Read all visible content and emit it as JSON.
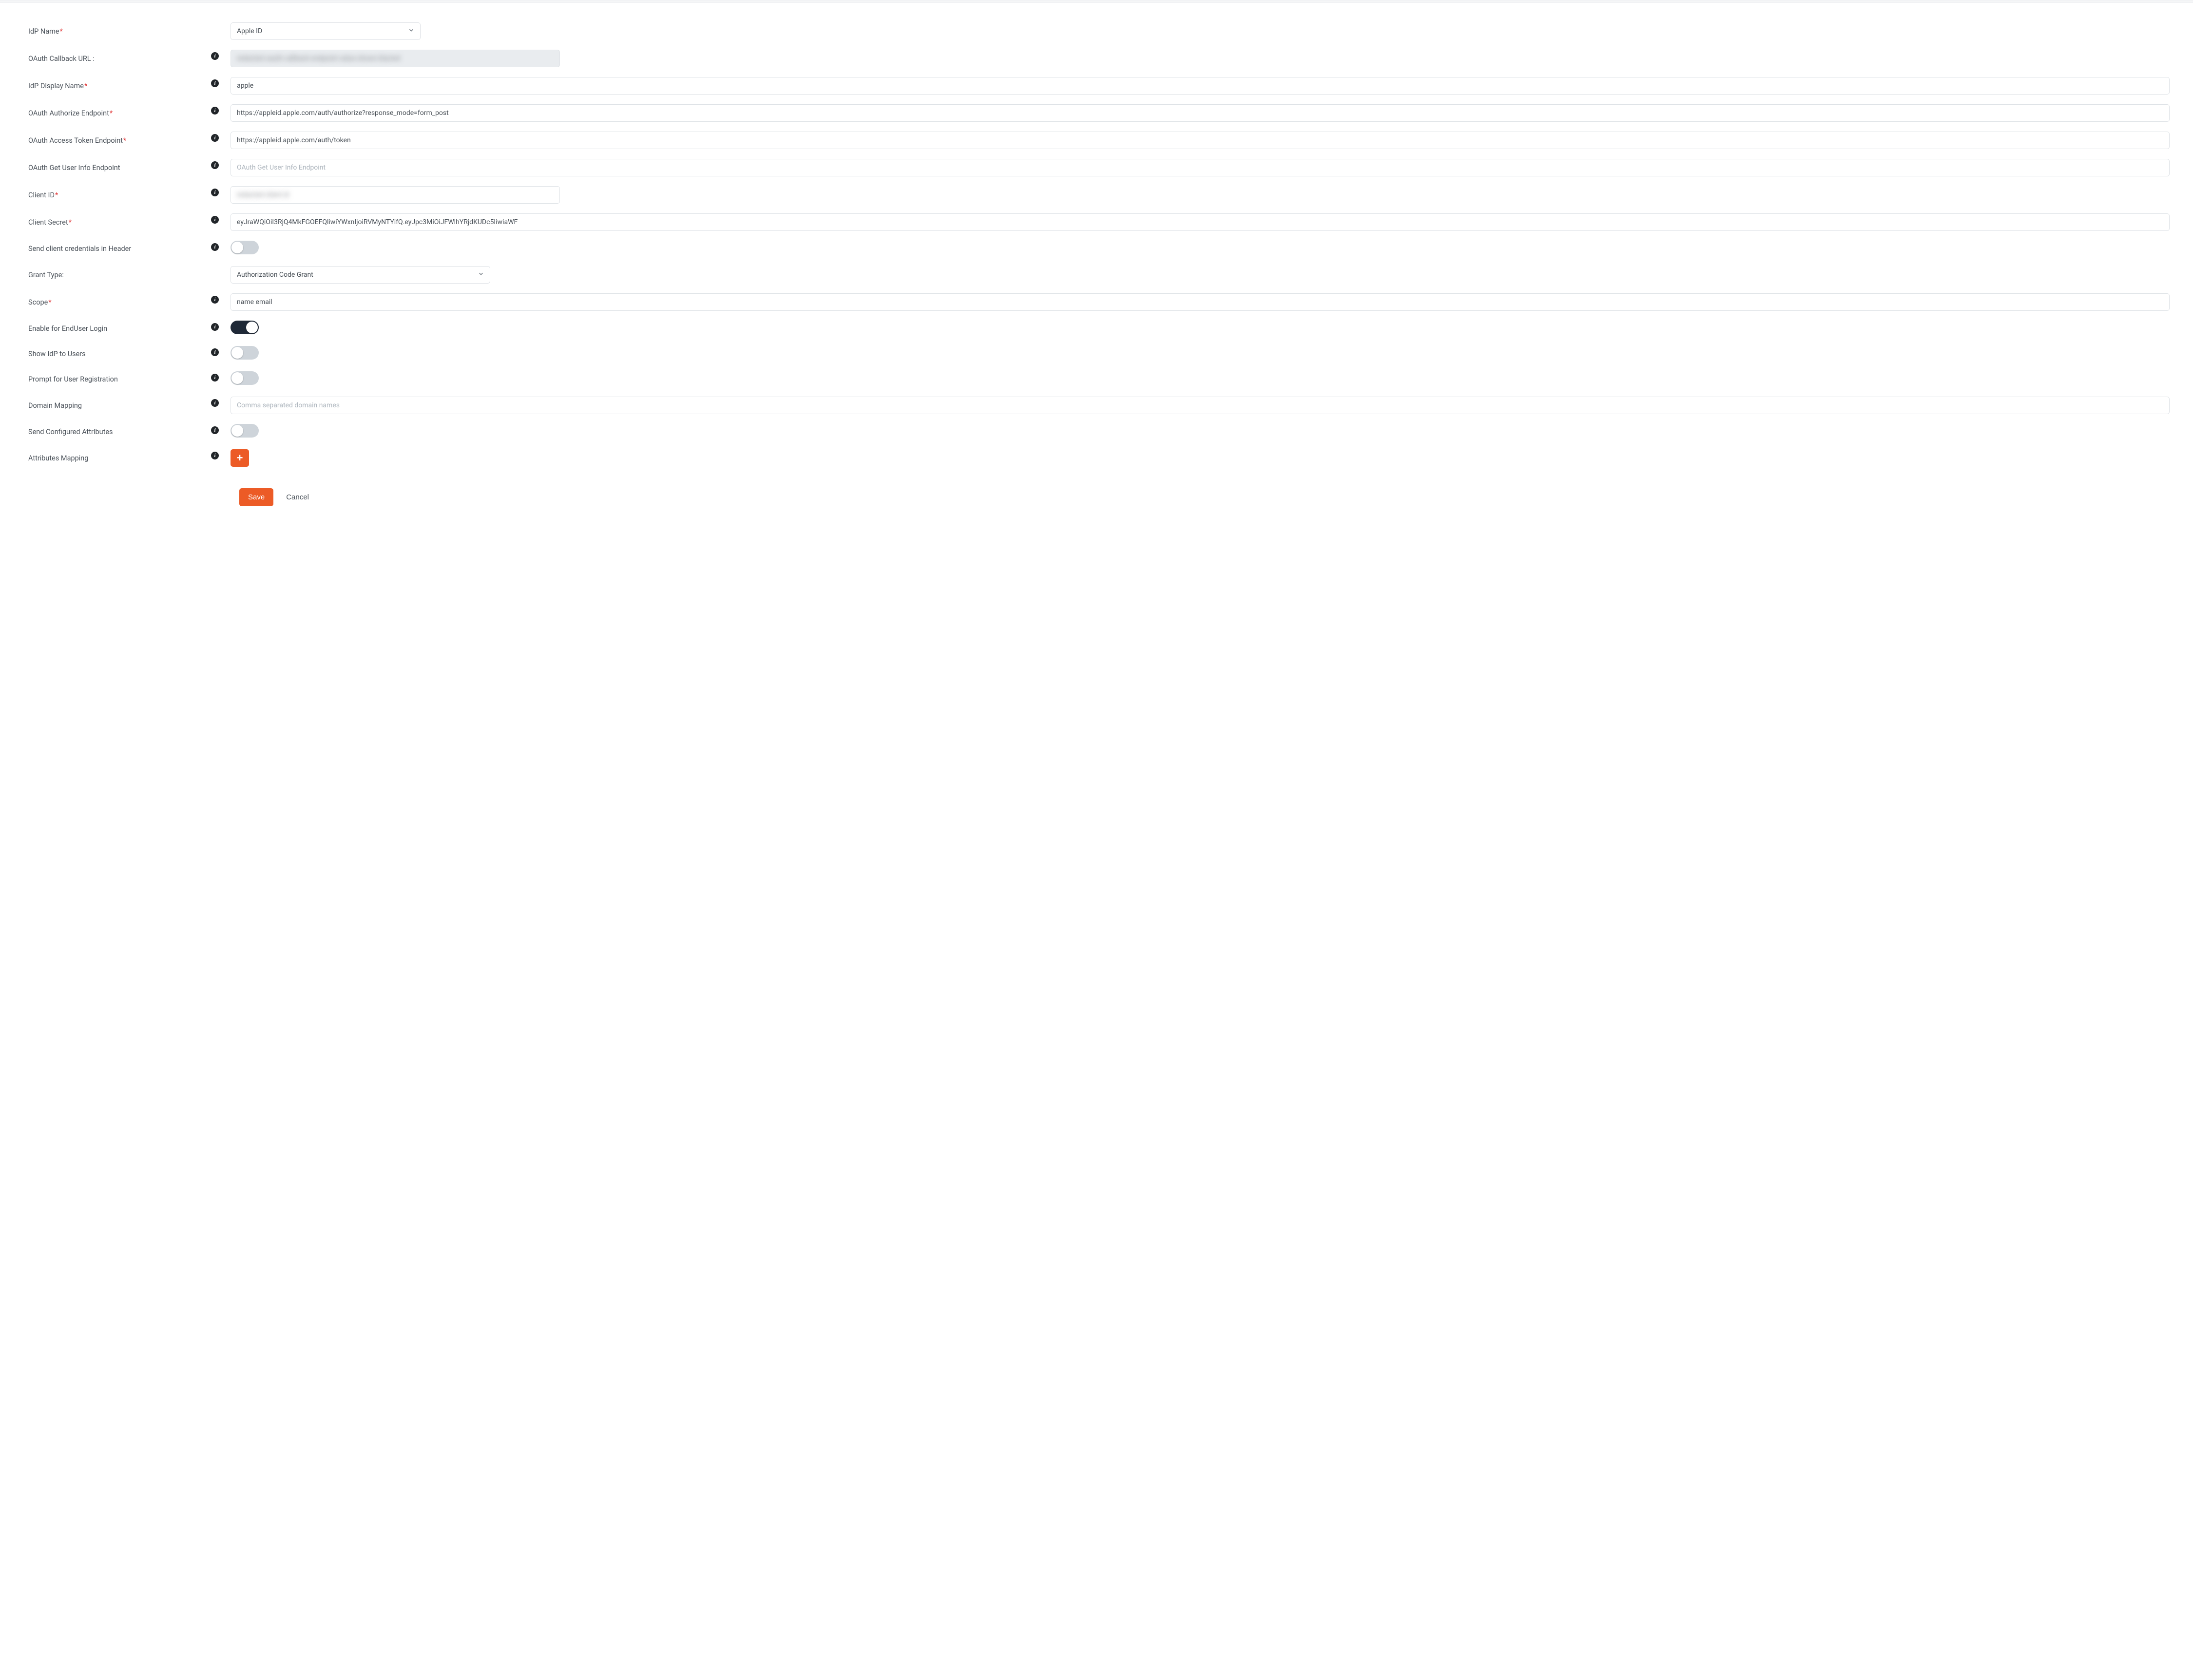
{
  "fields": {
    "idp_name": {
      "label": "IdP Name",
      "required": true,
      "info": false,
      "value": "Apple ID"
    },
    "callback": {
      "label": "OAuth Callback URL :",
      "required": false,
      "info": true,
      "value": "redacted oauth callback endpoint value shown blurred"
    },
    "display_name": {
      "label": "IdP Display Name",
      "required": true,
      "info": true,
      "value": "apple"
    },
    "authorize": {
      "label": "OAuth Authorize Endpoint",
      "required": true,
      "info": true,
      "value": "https://appleid.apple.com/auth/authorize?response_mode=form_post"
    },
    "token": {
      "label": "OAuth Access Token Endpoint",
      "required": true,
      "info": true,
      "value": "https://appleid.apple.com/auth/token"
    },
    "userinfo": {
      "label": "OAuth Get User Info Endpoint",
      "required": false,
      "info": true,
      "value": "",
      "placeholder": "OAuth Get User Info Endpoint"
    },
    "client_id": {
      "label": "Client ID",
      "required": true,
      "info": true,
      "value": "redacted client id"
    },
    "client_secret": {
      "label": "Client Secret",
      "required": true,
      "info": true,
      "value": "eyJraWQiOiI3RjQ4MkFGOEFQliwiYWxnIjoiRVMyNTYifQ.eyJpc3MiOiJFWlhYRjdKUDc5IiwiaWF"
    },
    "cred_header": {
      "label": "Send client credentials in Header",
      "required": false,
      "info": true,
      "on": false
    },
    "grant_type": {
      "label": "Grant Type:",
      "required": false,
      "info": false,
      "value": "Authorization Code Grant"
    },
    "scope": {
      "label": "Scope",
      "required": true,
      "info": true,
      "value": "name email"
    },
    "enduser": {
      "label": "Enable for EndUser Login",
      "required": false,
      "info": true,
      "on": true
    },
    "show_idp": {
      "label": "Show IdP to Users",
      "required": false,
      "info": true,
      "on": false
    },
    "prompt_reg": {
      "label": "Prompt for User Registration",
      "required": false,
      "info": true,
      "on": false
    },
    "domain_map": {
      "label": "Domain Mapping",
      "required": false,
      "info": true,
      "value": "",
      "placeholder": "Comma separated domain names"
    },
    "send_attrs": {
      "label": "Send Configured Attributes",
      "required": false,
      "info": true,
      "on": false
    },
    "attr_map": {
      "label": "Attributes Mapping",
      "required": false,
      "info": true
    }
  },
  "actions": {
    "save": "Save",
    "cancel": "Cancel"
  },
  "icons": {
    "info_glyph": "i",
    "plus_glyph": "+"
  }
}
